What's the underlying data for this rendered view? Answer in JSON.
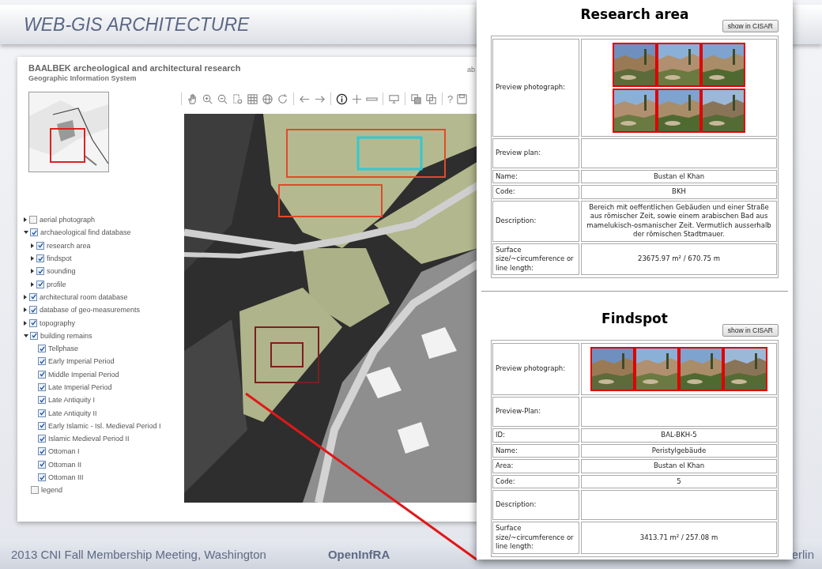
{
  "slide": {
    "title": "WEB-GIS ARCHITECTURE"
  },
  "app": {
    "title": "BAALBEK archeological and architectural research",
    "subtitle": "Geographic Information System",
    "header_link": "ab",
    "toolbar": {
      "help": "?"
    },
    "layers": [
      {
        "label": "aerial photograph",
        "checked": false,
        "expanded": false
      },
      {
        "label": "archaeological find database",
        "checked": true,
        "expanded": true,
        "children": [
          {
            "label": "research area",
            "checked": true,
            "expanded": false
          },
          {
            "label": "findspot",
            "checked": true,
            "expanded": false
          },
          {
            "label": "sounding",
            "checked": true,
            "expanded": false
          },
          {
            "label": "profile",
            "checked": true,
            "expanded": false
          }
        ]
      },
      {
        "label": "architectural room database",
        "checked": true,
        "expanded": false
      },
      {
        "label": "database of geo-measurements",
        "checked": true,
        "expanded": false
      },
      {
        "label": "topography",
        "checked": true,
        "expanded": false
      },
      {
        "label": "building remains",
        "checked": true,
        "expanded": true,
        "children": [
          {
            "label": "Tellphase",
            "checked": true
          },
          {
            "label": "Early Imperial Period",
            "checked": true
          },
          {
            "label": "Middle Imperial Period",
            "checked": true
          },
          {
            "label": "Late Imperial Period",
            "checked": true
          },
          {
            "label": "Late Antiquity I",
            "checked": true
          },
          {
            "label": "Late Antiquity II",
            "checked": true
          },
          {
            "label": "Early Islamic - Isl. Medieval Period I",
            "checked": true
          },
          {
            "label": "Islamic Medieval Period II",
            "checked": true
          },
          {
            "label": "Ottoman I",
            "checked": true
          },
          {
            "label": "Ottoman II",
            "checked": true
          },
          {
            "label": "Ottoman III",
            "checked": true
          }
        ]
      },
      {
        "label": "legend",
        "checked": false
      }
    ]
  },
  "popup": {
    "sections": [
      {
        "title": "Research area",
        "button": "show in CISAR",
        "rows": [
          {
            "kind": "photos",
            "label": "Preview photograph:"
          },
          {
            "kind": "empty",
            "label": "Preview plan:"
          },
          {
            "kind": "text",
            "label": "Name:",
            "value": "Bustan el Khan"
          },
          {
            "kind": "text",
            "label": "Code:",
            "value": "BKH"
          },
          {
            "kind": "text",
            "label": "Description:",
            "value": "Bereich mit oeffentlichen Gebäuden und einer Straße aus römischer Zeit, sowie einem arabischen Bad aus mamelukisch-osmanischer Zeit. Vermutlich ausserhalb der römischen Stadtmauer."
          },
          {
            "kind": "text",
            "label": "Surface size/~circumference or line length:",
            "value": "23675.97 m² / 670.75 m"
          }
        ]
      },
      {
        "title": "Findspot",
        "button": "show in CISAR",
        "rows": [
          {
            "kind": "photos",
            "label": "Preview photograph:"
          },
          {
            "kind": "empty",
            "label": "Preview-Plan:"
          },
          {
            "kind": "text",
            "label": "ID:",
            "value": "BAL-BKH-5"
          },
          {
            "kind": "text",
            "label": "Name:",
            "value": "Peristylgebäude"
          },
          {
            "kind": "text",
            "label": "Area:",
            "value": "Bustan el Khan"
          },
          {
            "kind": "text",
            "label": "Code:",
            "value": "5"
          },
          {
            "kind": "empty",
            "label": "Description:"
          },
          {
            "kind": "text",
            "label": "Surface size/~circumference or line length:",
            "value": "3413.71 m² / 257.08 m"
          }
        ]
      }
    ]
  },
  "footer": {
    "event": "2013 CNI Fall Membership Meeting, Washington",
    "project": "OpenInfRA",
    "right": "erlin"
  }
}
